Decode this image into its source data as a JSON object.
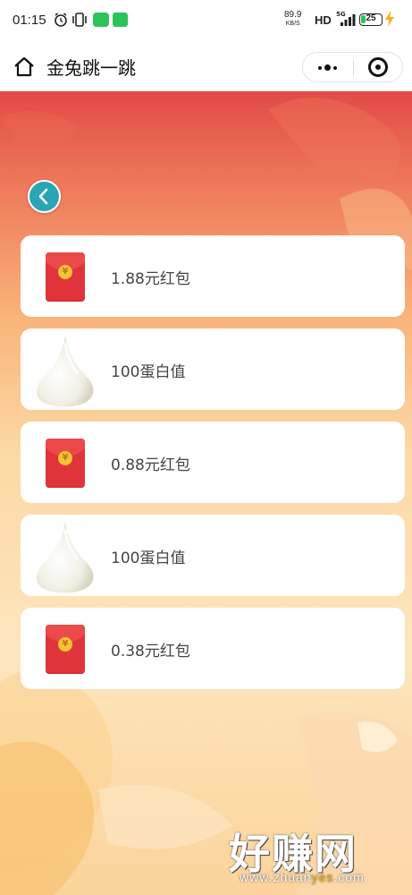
{
  "status_bar": {
    "time": "01:15",
    "speed_value": "89.9",
    "speed_unit": "KB/S",
    "hd": "HD",
    "network": "5G",
    "battery": "25",
    "battery_level": 0.25,
    "icons": [
      "alarm-icon",
      "vibrate-icon",
      "wechat-icon",
      "message-icon",
      "signal-icon",
      "battery-icon",
      "charging-icon"
    ]
  },
  "nav": {
    "title": "金兔跳一跳",
    "home_icon": "home-icon",
    "more_icon": "more-dots-icon",
    "close_icon": "close-miniprogram-icon"
  },
  "back_icon": "chevron-left-icon",
  "rewards": [
    {
      "label": "1.88元红包",
      "icon": "red-packet-icon"
    },
    {
      "label": "100蛋白值",
      "icon": "egg-white-drop-icon"
    },
    {
      "label": "0.88元红包",
      "icon": "red-packet-icon"
    },
    {
      "label": "100蛋白值",
      "icon": "egg-white-drop-icon"
    },
    {
      "label": "0.38元红包",
      "icon": "red-packet-icon"
    }
  ],
  "red_packet_symbol": "¥",
  "watermark": {
    "main": "好赚网",
    "sub_a": "www.zhuan",
    "sub_b": "yes",
    "sub_c": ".com"
  },
  "colors": {
    "accent_back": "#2ba5b6",
    "red_packet": "#e0343a",
    "coin": "#f7c531",
    "top_gradient": "#e24a47",
    "bottom_gradient": "#fde6bd"
  }
}
